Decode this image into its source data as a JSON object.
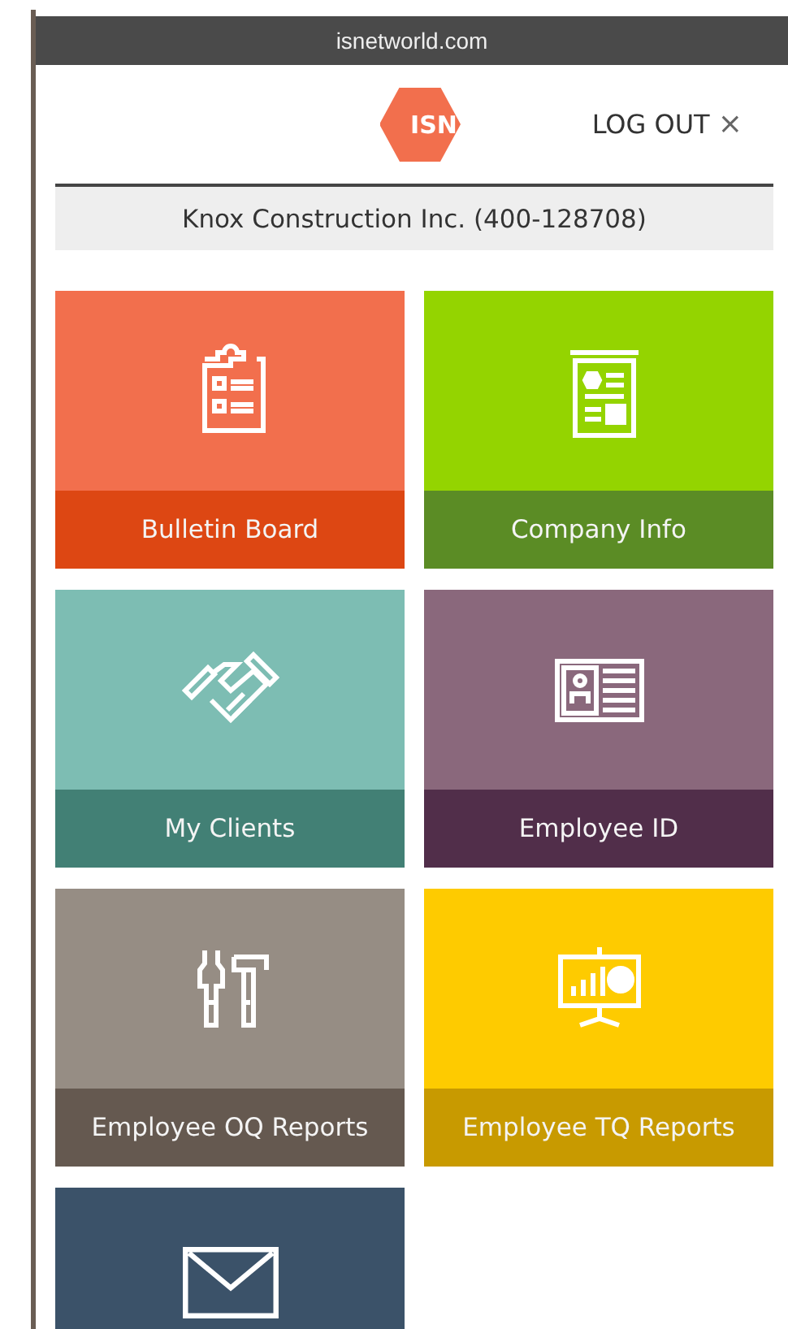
{
  "browser": {
    "url": "isnetworld.com"
  },
  "header": {
    "logo": "ISN",
    "logout": "LOG OUT",
    "close_glyph": "×"
  },
  "company_bar": {
    "text": "Knox Construction Inc. (400-128708)"
  },
  "tiles": [
    {
      "label": {
        "text": "Bulletin Board",
        "color": "#dd4713"
      },
      "kind": "clipboard",
      "color": "#f26f4d"
    },
    {
      "label": {
        "text": "Company Info",
        "color": "#5b8c25"
      },
      "kind": "newsletter",
      "color": "#94d400"
    },
    {
      "label": {
        "text": "My Clients",
        "color": "#428075"
      },
      "kind": "handshake",
      "color": "#7dbdb3"
    },
    {
      "label": {
        "text": "Employee ID",
        "color": "#512e4a"
      },
      "kind": "id-card",
      "color": "#8a687c"
    },
    {
      "label": {
        "text": "Employee OQ Reports",
        "color": "#655950"
      },
      "kind": "tools",
      "color": "#968d84"
    },
    {
      "label": {
        "text": "Employee TQ Reports",
        "color": "#c89a00"
      },
      "kind": "presentation",
      "color": "#fecb00"
    },
    {
      "kind": "envelope",
      "color": "#3b5269"
    }
  ]
}
